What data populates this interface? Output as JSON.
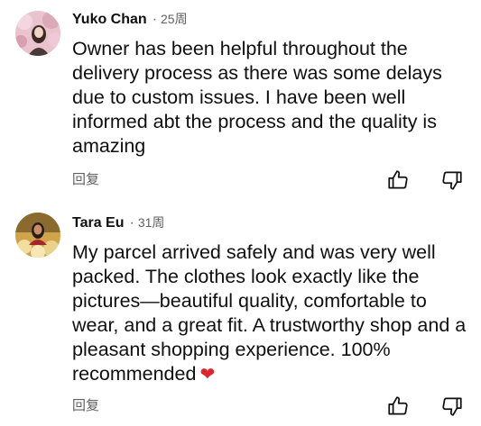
{
  "comments": [
    {
      "author": "Yuko Chan",
      "separator": "·",
      "time": "25周",
      "text": "Owner has been helpful throughout the delivery process as there was some delays due to custom issues.  I have been well informed abt the process and the quality is amazing",
      "reply_label": "回复",
      "avatar_icon": "user-avatar-pink-blossom",
      "like_icon": "thumbs-up-icon",
      "dislike_icon": "thumbs-down-icon"
    },
    {
      "author": "Tara Eu",
      "separator": "·",
      "time": "31周",
      "text": "My parcel arrived safely and was very well packed. The clothes look exactly like the pictures—beautiful quality, comfortable to wear, and a great fit. A trustworthy shop and a pleasant shopping experience. 100% recommended",
      "emoji": "❤",
      "reply_label": "回复",
      "avatar_icon": "user-avatar-flowers",
      "like_icon": "thumbs-up-icon",
      "dislike_icon": "thumbs-down-icon"
    }
  ],
  "colors": {
    "text": "#0f0f0f",
    "secondary": "#606060",
    "heart": "#e0242b"
  }
}
